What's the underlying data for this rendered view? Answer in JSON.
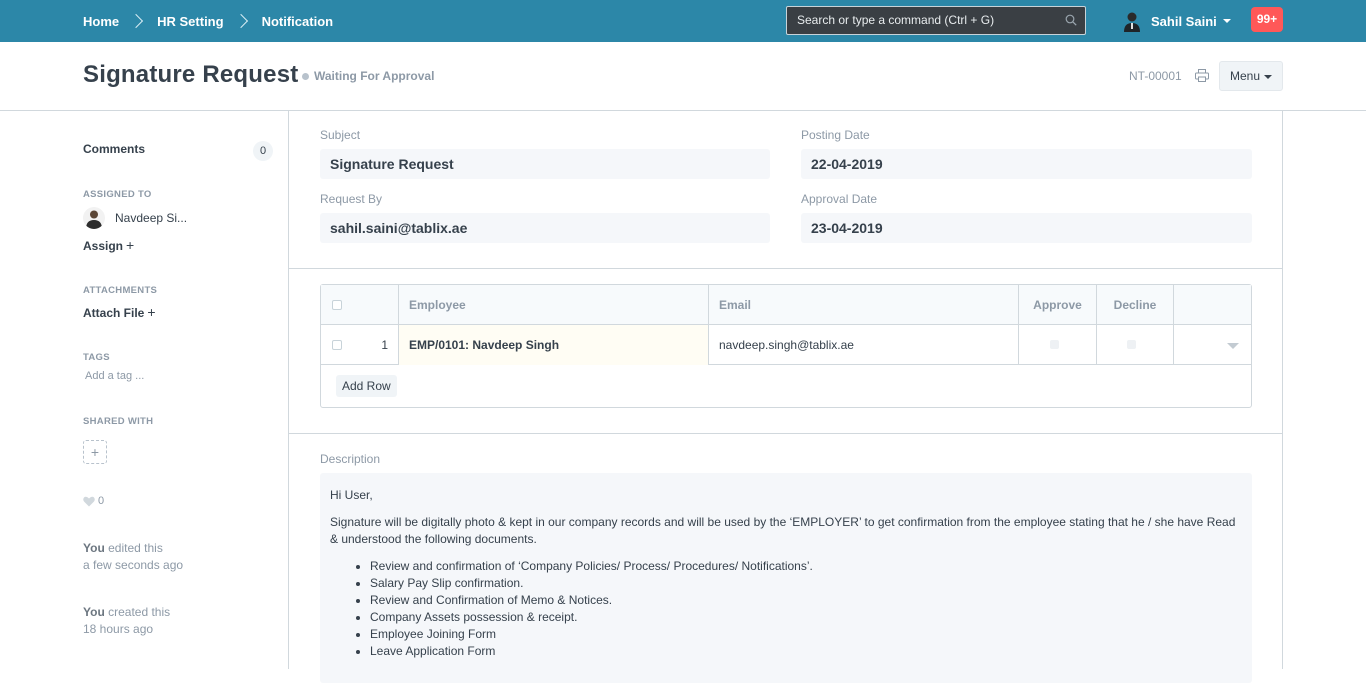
{
  "navbar": {
    "breadcrumbs": [
      "Home",
      "HR Setting",
      "Notification"
    ],
    "search_placeholder": "Search or type a command (Ctrl + G)",
    "user_name": "Sahil Saini",
    "notifications": "99+"
  },
  "header": {
    "title": "Signature Request",
    "status": "Waiting For Approval",
    "doc_id": "NT-00001",
    "menu_label": "Menu"
  },
  "sidebar": {
    "comments_label": "Comments",
    "comments_count": "0",
    "assigned_heading": "ASSIGNED TO",
    "assignee": "Navdeep Si...",
    "assign_label": "Assign",
    "attachments_heading": "ATTACHMENTS",
    "attach_label": "Attach File",
    "tags_heading": "TAGS",
    "tag_placeholder": "Add a tag ...",
    "shared_heading": "SHARED WITH",
    "likes": "0",
    "activity": [
      {
        "who": "You",
        "action": " edited this",
        "when": "a few seconds ago"
      },
      {
        "who": "You",
        "action": " created this",
        "when": "18 hours ago"
      }
    ]
  },
  "form": {
    "subject_label": "Subject",
    "subject_value": "Signature Request",
    "posting_date_label": "Posting Date",
    "posting_date_value": "22-04-2019",
    "request_by_label": "Request By",
    "request_by_value": "sahil.saini@tablix.ae",
    "approval_date_label": "Approval Date",
    "approval_date_value": "23-04-2019"
  },
  "table": {
    "columns": [
      "Employee",
      "Email",
      "Approve",
      "Decline"
    ],
    "rows": [
      {
        "idx": "1",
        "employee": "EMP/0101: Navdeep Singh",
        "email": "navdeep.singh@tablix.ae"
      }
    ],
    "add_row_label": "Add Row"
  },
  "description": {
    "label": "Description",
    "greeting": "Hi User,",
    "body": "Signature will be digitally photo & kept in our company records and will be used by the ‘EMPLOYER’ to get confirmation from the employee stating that he / she have Read & understood the following documents.",
    "items": [
      "Review and confirmation of ‘Company Policies/ Process/ Procedures/ Notifications’.",
      "Salary Pay Slip confirmation.",
      "Review and Confirmation of Memo & Notices.",
      "Company Assets possession & receipt.",
      "Employee Joining Form",
      "Leave Application Form"
    ]
  },
  "colors": {
    "navbar": "#2c87a8",
    "notification_badge": "#ff5858",
    "text": "#36414c",
    "muted": "#8d99a6"
  }
}
